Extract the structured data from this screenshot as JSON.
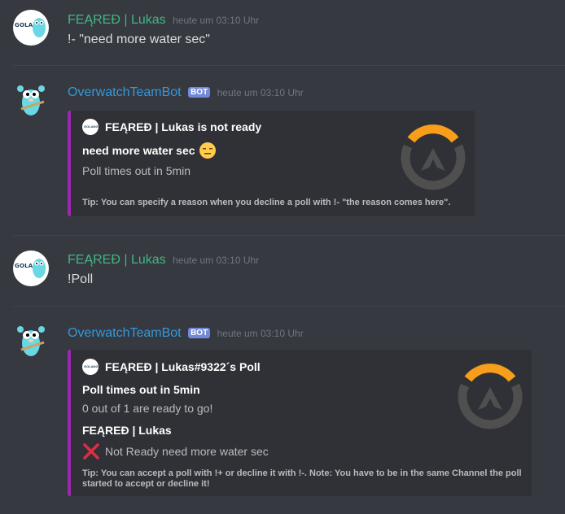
{
  "messages": [
    {
      "username": "FEĄREĐ | Lukas",
      "avatar_text": "GOLANG",
      "timestamp": "heute um 03:10 Uhr",
      "text": "!- \"need more water sec\""
    },
    {
      "username": "OverwatchTeamBot",
      "bot_tag": "BOT",
      "timestamp": "heute um 03:10 Uhr",
      "embed": {
        "author": "FEĄREĐ | Lukas is not ready",
        "author_icon_text": "GOLANG",
        "title": "need more water sec",
        "description": "Poll times out in 5min",
        "footer": "Tip: You can specify a reason when you decline a poll with !- \"the reason comes here\".",
        "thumbnail": "overwatch-logo",
        "color": "#9c27b0"
      }
    },
    {
      "username": "FEĄREĐ | Lukas",
      "avatar_text": "GOLANG",
      "timestamp": "heute um 03:10 Uhr",
      "text": "!Poll"
    },
    {
      "username": "OverwatchTeamBot",
      "bot_tag": "BOT",
      "timestamp": "heute um 03:10 Uhr",
      "embed": {
        "author": "FEĄREĐ | Lukas#9322´s Poll",
        "author_icon_text": "GOLANG",
        "title": "Poll times out in 5min",
        "description": "0 out of 1 are ready to go!",
        "field_name": "FEĄREĐ | Lukas",
        "field_value": "Not Ready need more water sec",
        "field_icon": "cross-mark-icon",
        "footer": "Tip: You can accept a poll with !+ or decline it with !-. Note: You have to be in the same Channel the poll started to accept or decline it!",
        "thumbnail": "overwatch-logo",
        "color": "#9c27b0"
      }
    }
  ],
  "colors": {
    "background": "#36393f",
    "embed_background": "#2f3136",
    "username_user": "#43b581",
    "username_bot": "#3498db",
    "bot_tag": "#7289da",
    "timestamp": "#72767d",
    "overwatch_orange": "#f99e1a",
    "overwatch_gray": "#4f4f4f"
  }
}
